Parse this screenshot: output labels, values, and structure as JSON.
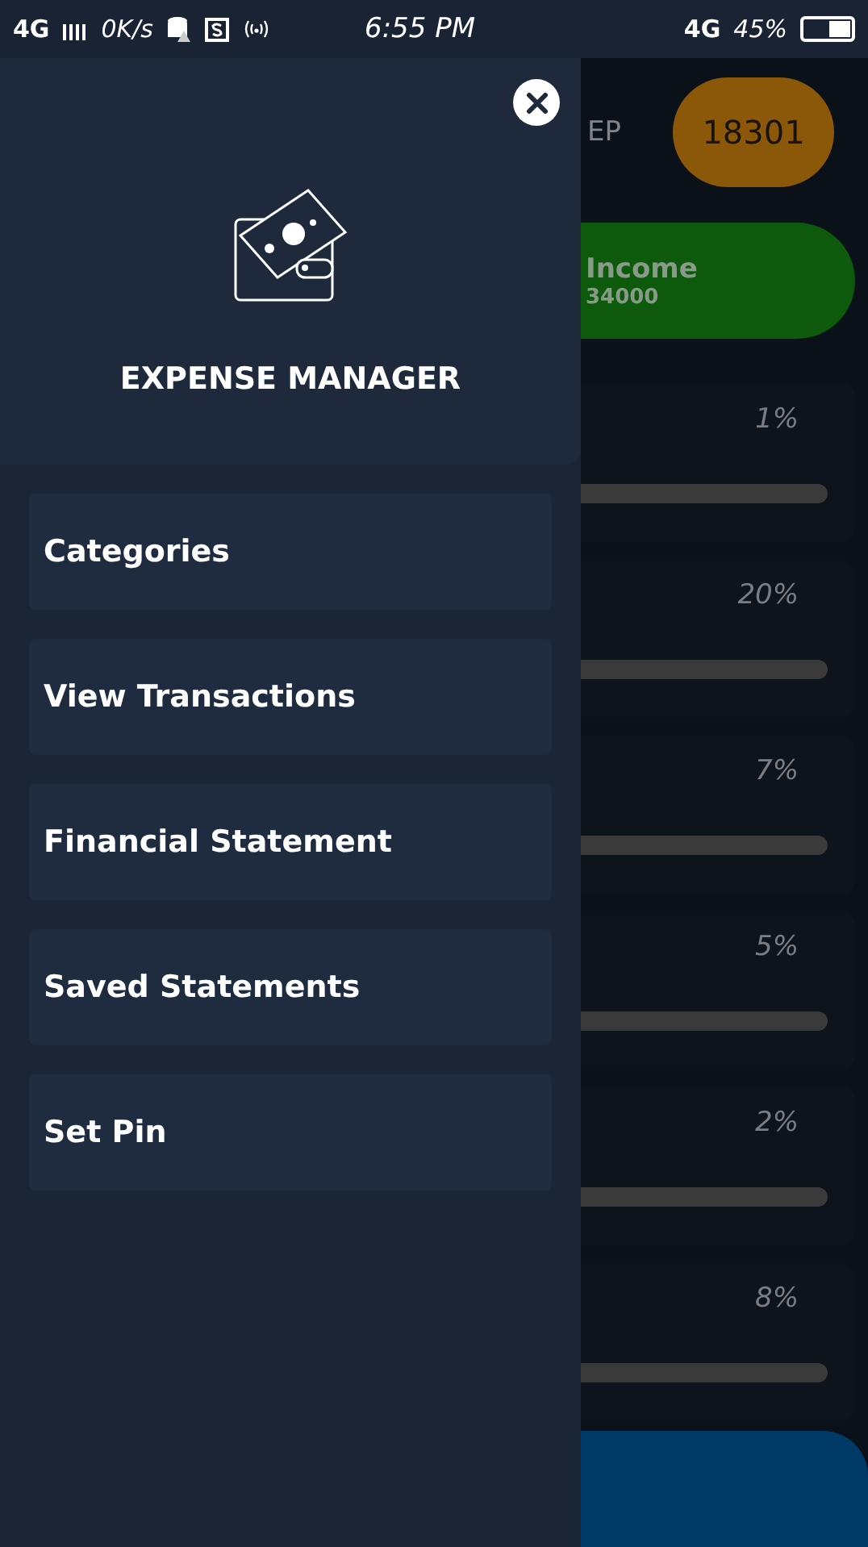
{
  "status_bar": {
    "network": "4G",
    "speed": "0K/s",
    "time": "6:55 PM",
    "data_type": "4G",
    "battery": "45%"
  },
  "drawer": {
    "title": "EXPENSE MANAGER",
    "menu": [
      {
        "label": "Categories"
      },
      {
        "label": "View Transactions"
      },
      {
        "label": "Financial Statement"
      },
      {
        "label": "Saved Statements"
      },
      {
        "label": "Set Pin"
      }
    ]
  },
  "dashboard": {
    "header_text": "EP",
    "balance": "18301",
    "income": {
      "label": "Income",
      "amount": "34000"
    },
    "categories": [
      {
        "percent": "1%"
      },
      {
        "percent": "20%"
      },
      {
        "percent": "7%"
      },
      {
        "percent": "5%"
      },
      {
        "percent": "2%"
      },
      {
        "percent": "8%"
      }
    ]
  }
}
